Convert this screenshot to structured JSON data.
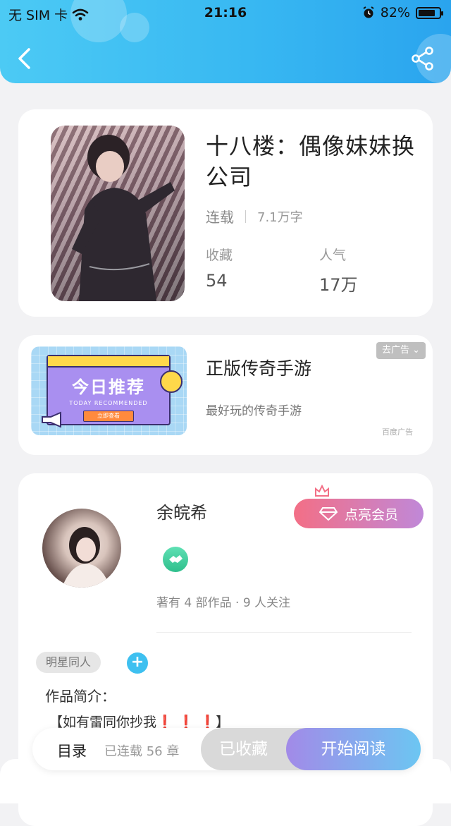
{
  "status_bar": {
    "carrier": "无 SIM 卡",
    "time": "21:16",
    "battery": "82%",
    "battery_level": 0.82
  },
  "book": {
    "title": "十八楼：偶像妹妹换公司",
    "status": "连载",
    "words": "7.1万字",
    "favorites_label": "收藏",
    "favorites_value": "54",
    "popularity_label": "人气",
    "popularity_value": "17万"
  },
  "ad": {
    "title": "正版传奇手游",
    "description": "最好玩的传奇手游",
    "remove_ad": "去广告",
    "source": "百度广告",
    "banner_title": "今日推荐",
    "banner_subtitle": "TODAY RECOMMENDED",
    "banner_button": "立即查看"
  },
  "author": {
    "name": "余皖希",
    "vip_button": "点亮会员",
    "meta": "著有 4 部作品 · 9 人关注",
    "tag": "明星同人",
    "add_tag": "+",
    "intro_label": "作品简介：",
    "intro_open": "【如有雷同你抄我",
    "intro_marks": "❗ ❗ ❗",
    "intro_close": "】"
  },
  "bottom_bar": {
    "toc_label": "目录",
    "chapters": "已连载 56 章",
    "collected_label": "已收藏",
    "read_label": "开始阅读"
  },
  "colors": {
    "accent": "#38b8f2",
    "vip_start": "#f36f86",
    "vip_end": "#c088d8"
  }
}
